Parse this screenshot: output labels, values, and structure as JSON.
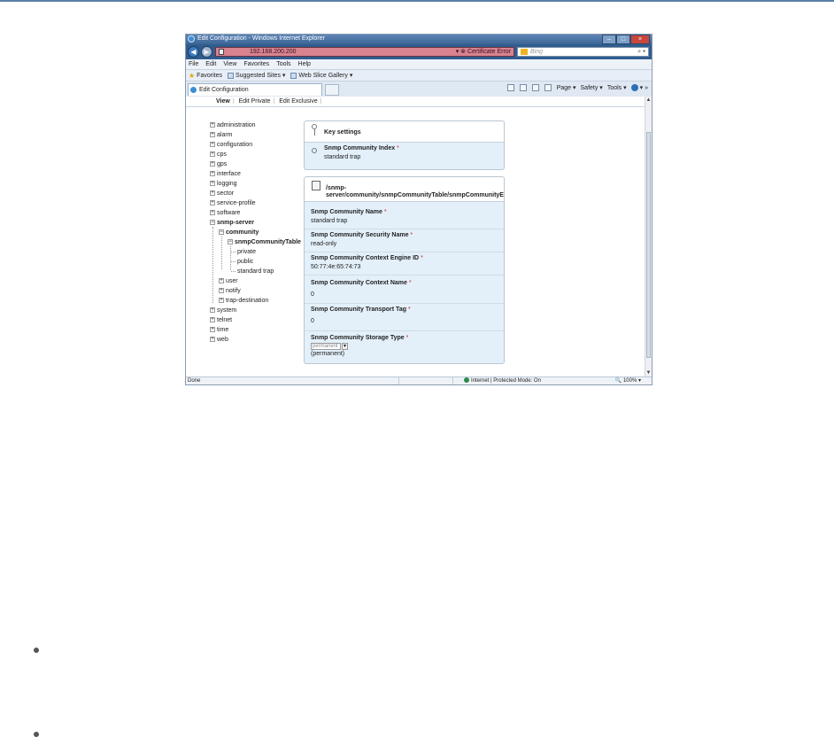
{
  "window": {
    "title": "Edit Configuration - Windows Internet Explorer",
    "controls": [
      "minimize",
      "maximize",
      "close"
    ]
  },
  "addressbar": {
    "url": "192.168.200.200",
    "cert_error": "Certificate Error",
    "search_placeholder": "Bing",
    "search_icon": "magnifier-icon"
  },
  "menu": [
    "File",
    "Edit",
    "View",
    "Favorites",
    "Tools",
    "Help"
  ],
  "favorites": {
    "label": "Favorites",
    "items": [
      "Suggested Sites ▾",
      "Web Slice Gallery ▾"
    ]
  },
  "tab": {
    "label": "Edit Configuration"
  },
  "commandbar": [
    "Page ▾",
    "Safety ▾",
    "Tools ▾"
  ],
  "view_links": {
    "view": "View",
    "edit_private": "Edit Private",
    "edit_exclusive": "Edit Exclusive"
  },
  "tree": {
    "administration": "administration",
    "alarm": "alarm",
    "configuration": "configuration",
    "cps": "cps",
    "gps": "gps",
    "interface": "interface",
    "logging": "logging",
    "sector": "sector",
    "service_profile": "service-profile",
    "software": "software",
    "snmp_server": "snmp-server",
    "community": "community",
    "snmpCommunityTable": "snmpCommunityTable",
    "private": "private",
    "public": "public",
    "standard_trap": "standard trap",
    "user": "user",
    "notify": "notify",
    "trap_destination": "trap-destination",
    "system": "system",
    "telnet": "telnet",
    "time": "time",
    "web": "web"
  },
  "key_settings": {
    "title": "Key settings",
    "index_label": "Snmp Community Index",
    "index_value": "standard trap",
    "required_mark": "*"
  },
  "entry": {
    "path_line1": "/snmp-",
    "path_line2": "server/community/snmpCommunityTable/snmpCommunityEntry",
    "fields": {
      "name": {
        "label": "Snmp Community Name",
        "value": "standard trap"
      },
      "security_name": {
        "label": "Snmp Community Security Name",
        "value": "read-only"
      },
      "engine_id": {
        "label": "Snmp Community Context Engine ID",
        "value": "50:77:4e:65:74:73"
      },
      "context_name": {
        "label": "Snmp Community Context Name",
        "value": "0"
      },
      "transport_tag": {
        "label": "Snmp Community Transport Tag",
        "value": "0"
      },
      "storage_type": {
        "label": "Snmp Community Storage Type",
        "select_value": "permanent",
        "value": "(permanent)"
      }
    }
  },
  "statusbar": {
    "left": "Done",
    "zone": "Internet | Protected Mode: On",
    "zoom": "100%"
  }
}
